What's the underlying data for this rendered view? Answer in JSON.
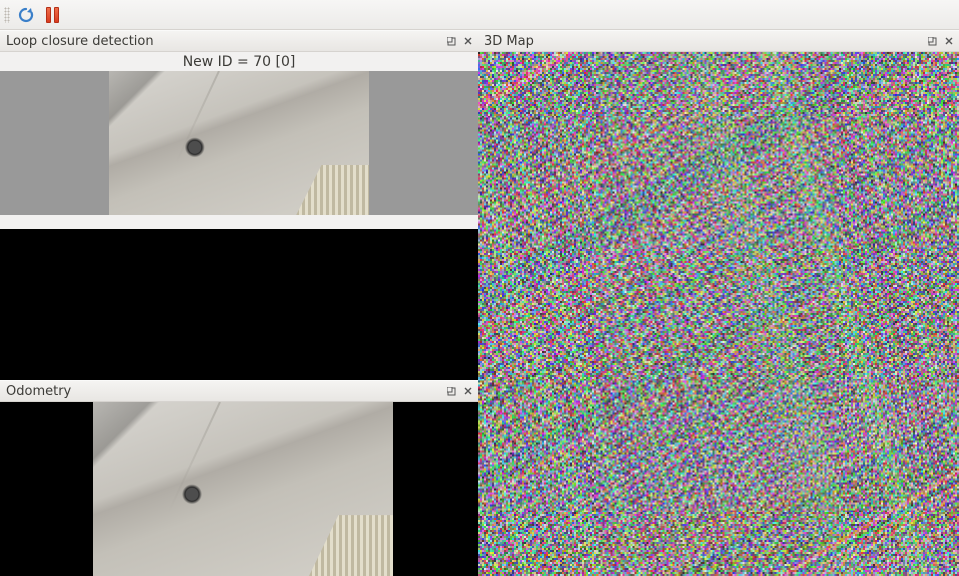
{
  "toolbar": {
    "refresh_tooltip": "Refresh",
    "pause_tooltip": "Pause"
  },
  "panels": {
    "loop": {
      "title": "Loop closure detection",
      "status": "New ID = 70 [0]"
    },
    "odom": {
      "title": "Odometry"
    },
    "map3d": {
      "title": "3D Map"
    }
  },
  "icon_names": {
    "detach": "detach-icon",
    "close": "close-icon"
  }
}
